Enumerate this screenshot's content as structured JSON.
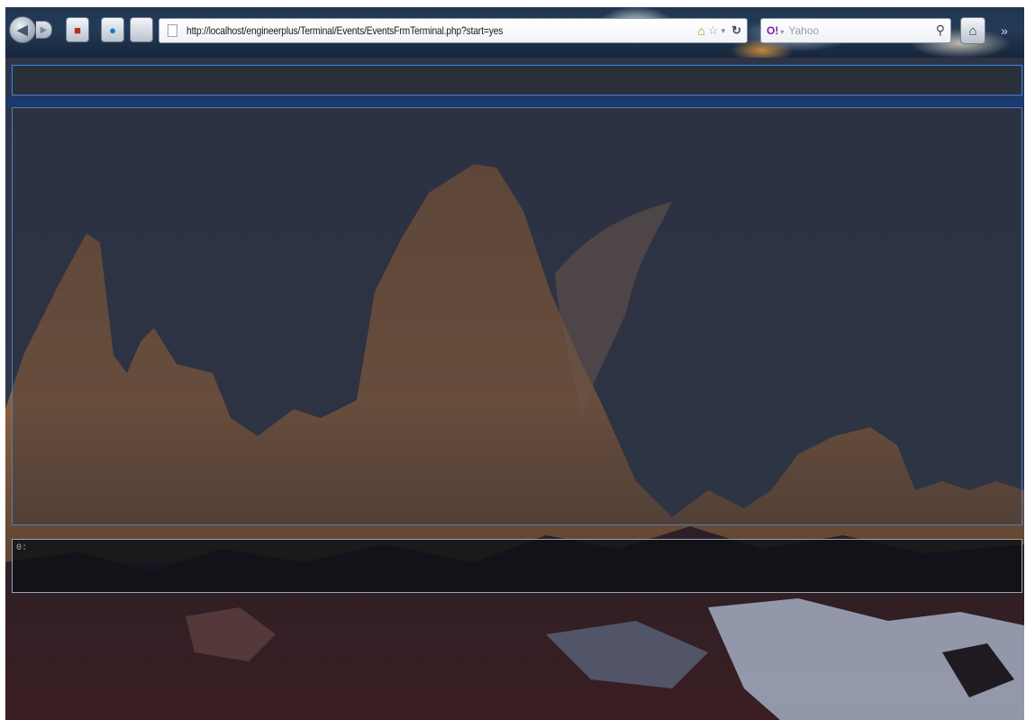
{
  "browser": {
    "url": "http://localhost/engineerplus/Terminal/Events/EventsFrmTerminal.php?start=yes",
    "search_engine_label": "O!",
    "search_placeholder": "Yahoo",
    "icons": {
      "back": "back-arrow-icon",
      "forward": "forward-arrow-icon",
      "page": "page-icon",
      "bookmark": "star-icon",
      "reload": "reload-icon",
      "search": "magnifier-icon",
      "home": "home-icon"
    }
  },
  "page": {
    "console_text": "0:",
    "accent_border": "#4a7fc4",
    "panel_bg": "#2a2f3a"
  }
}
